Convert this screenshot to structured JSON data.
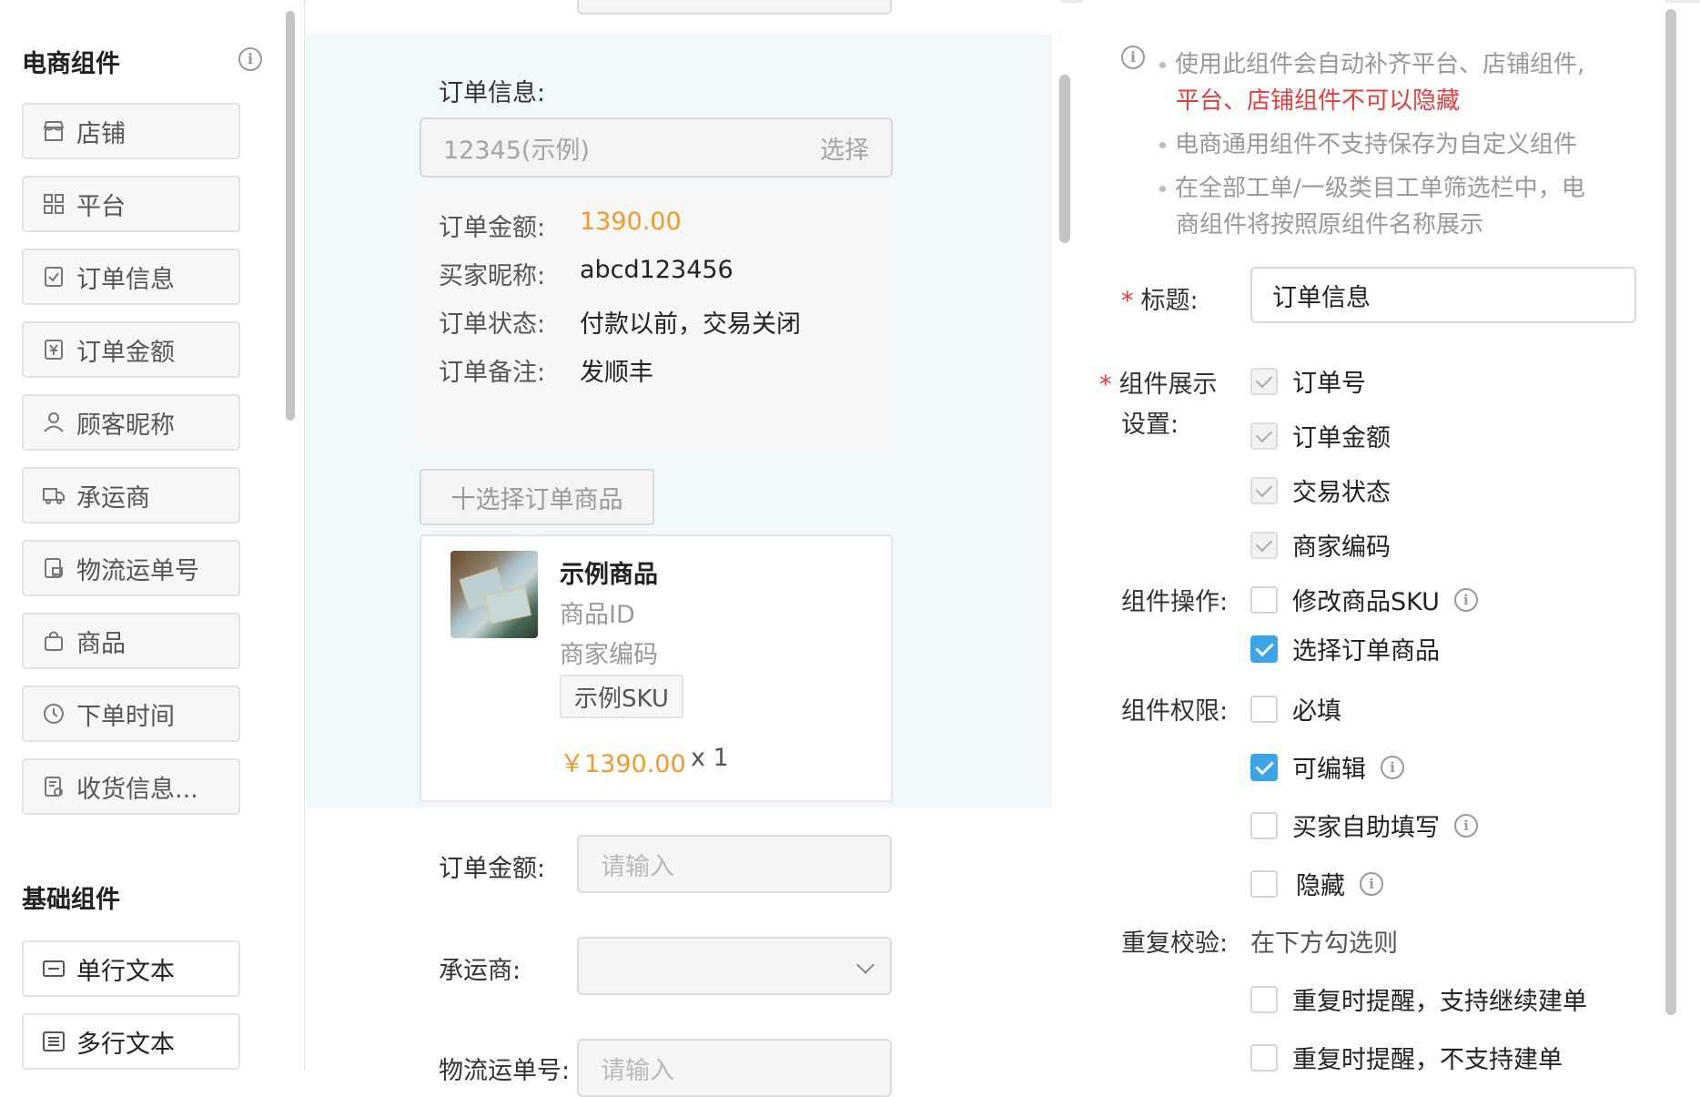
{
  "palette": {
    "ecommerce_title": "电商组件",
    "ecommerce_items": [
      {
        "label": "店铺",
        "icon": "store-icon"
      },
      {
        "label": "平台",
        "icon": "grid-icon"
      },
      {
        "label": "订单信息",
        "icon": "order-check-icon"
      },
      {
        "label": "订单金额",
        "icon": "yen-doc-icon"
      },
      {
        "label": "顾客昵称",
        "icon": "user-icon"
      },
      {
        "label": "承运商",
        "icon": "truck-icon"
      },
      {
        "label": "物流运单号",
        "icon": "logistics-doc-icon"
      },
      {
        "label": "商品",
        "icon": "bag-icon"
      },
      {
        "label": "下单时间",
        "icon": "clock-icon"
      },
      {
        "label": "收货信息...",
        "icon": "address-doc-icon"
      }
    ],
    "basic_title": "基础组件",
    "basic_items": [
      {
        "label": "单行文本",
        "icon": "single-line-icon"
      },
      {
        "label": "多行文本",
        "icon": "multi-line-icon"
      }
    ]
  },
  "canvas": {
    "order_label": "订单信息:",
    "order_value": "12345(示例)",
    "order_select": "选择",
    "info_rows": [
      {
        "k": "订单金额:",
        "v": "1390.00"
      },
      {
        "k": "买家昵称:",
        "v": "abcd123456"
      },
      {
        "k": "订单状态:",
        "v": "付款以前，交易关闭"
      },
      {
        "k": "订单备注:",
        "v": "发顺丰"
      }
    ],
    "add_goods": "十选择订单商品",
    "goods": {
      "name": "示例商品",
      "id_label": "商品ID",
      "code_label": "商家编码",
      "sku": "示例SKU",
      "price": "￥1390.00",
      "qty": "x 1"
    },
    "amount_label": "订单金额:",
    "amount_placeholder": "请输入",
    "carrier_label": "承运商:",
    "waybill_label": "物流运单号:",
    "waybill_placeholder": "请输入"
  },
  "props": {
    "tip1": "使用此组件会自动补齐平台、店铺组件,",
    "tip1_red": "平台、店铺组件不可以隐藏",
    "tip2": "电商通用组件不支持保存为自定义组件",
    "tip3a": "在全部工单/一级类目工单筛选栏中，电",
    "tip3b": "商组件将按照原组件名称展示",
    "title_label": "标题:",
    "title_value": "订单信息",
    "display_label_a": "组件展示",
    "display_label_b": "设置:",
    "display_opts": [
      "订单号",
      "订单金额",
      "交易状态",
      "商家编码"
    ],
    "ops_label": "组件操作:",
    "ops_opts": [
      {
        "label": "修改商品SKU",
        "checked": false
      },
      {
        "label": "选择订单商品",
        "checked": true
      }
    ],
    "perm_label": "组件权限:",
    "perm_opts": [
      {
        "label": "必填",
        "checked": false
      },
      {
        "label": "可编辑",
        "checked": true
      },
      {
        "label": "买家自助填写",
        "checked": false
      },
      {
        "label": "隐藏",
        "checked": false
      }
    ],
    "dup_label": "重复校验:",
    "dup_hint": "在下方勾选则",
    "dup_opts": [
      "重复时提醒，支持继续建单",
      "重复时提醒，不支持建单"
    ]
  },
  "colors": {
    "accent": "#3aa5e8",
    "price": "#f39a2b",
    "required": "#e53d3d",
    "canvas_bg": "#f1f8fb"
  }
}
